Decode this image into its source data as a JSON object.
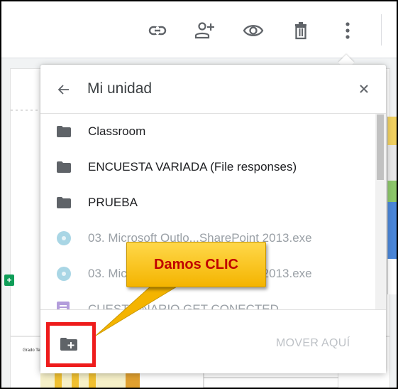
{
  "toolbar": {
    "icons": [
      "link-icon",
      "add-person-icon",
      "eye-icon",
      "trash-icon",
      "more-vert-icon"
    ]
  },
  "doc": {
    "badge": "+",
    "grade_label": "Grado Te"
  },
  "dialog": {
    "title": "Mi unidad",
    "back_icon": "arrow-left-icon",
    "close_icon": "close-icon",
    "files": [
      {
        "name": "Classroom",
        "icon": "folder-icon",
        "type": "folder"
      },
      {
        "name": "ENCUESTA VARIADA (File responses)",
        "icon": "folder-icon",
        "type": "folder"
      },
      {
        "name": "PRUEBA",
        "icon": "folder-icon",
        "type": "folder"
      },
      {
        "name": "03. Microsoft Outlo...SharePoint 2013.exe",
        "icon": "disc-icon",
        "type": "file"
      },
      {
        "name": "03. Microsoft Outlo...SharePoint 2013.exe",
        "icon": "disc-icon",
        "type": "file"
      },
      {
        "name": "CUESTIONARIO GET CONECTED",
        "icon": "form-icon",
        "type": "file"
      }
    ],
    "footer": {
      "new_folder_icon": "new-folder-icon",
      "move_label": "MOVER AQUÍ"
    }
  },
  "annotation": {
    "callout": "Damos CLIC",
    "callout_color": "#f4b400",
    "highlight_color": "#ee1c1c"
  }
}
